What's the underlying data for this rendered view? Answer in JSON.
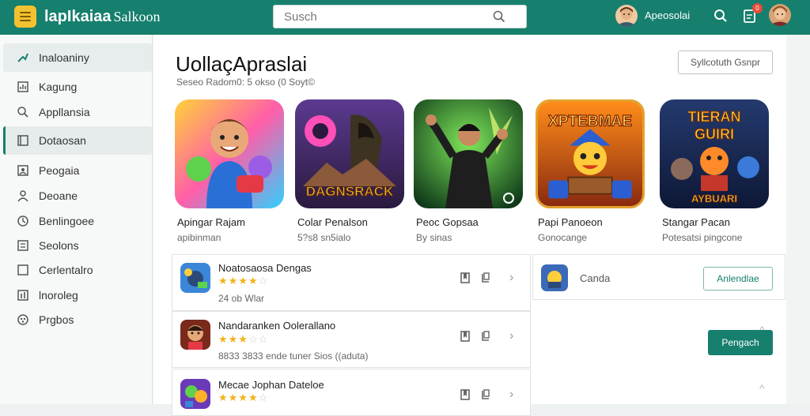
{
  "header": {
    "app_title_bold": "lapIkaiaa",
    "app_title_light": "Salkoon",
    "search_placeholder": "Susch",
    "user_name": "Apeosolai",
    "notification_count": "0"
  },
  "sidebar": {
    "items": [
      {
        "label": "Inaloaniny",
        "icon": "trend-arrow-icon"
      },
      {
        "label": "Kagung",
        "icon": "chart-icon"
      },
      {
        "label": "Appllansia",
        "icon": "search-icon"
      },
      {
        "label": "Dotaosan",
        "icon": "bookmark-icon"
      },
      {
        "label": "Peogaia",
        "icon": "people-icon"
      },
      {
        "label": "Deoane",
        "icon": "person-icon"
      },
      {
        "label": "Benlingoee",
        "icon": "clock-icon"
      },
      {
        "label": "Seolons",
        "icon": "list-icon"
      },
      {
        "label": "Cerlentalro",
        "icon": "square-icon"
      },
      {
        "label": "lnoroleg",
        "icon": "bar-chart-icon"
      },
      {
        "label": "Prgbos",
        "icon": "puzzle-icon"
      }
    ]
  },
  "main": {
    "title": "UollaçApraslai",
    "subtitle": "Seseo Radom0: 5 okso (0 Soyt©",
    "header_button": "Syllcotuth Gsnpr",
    "featured": [
      {
        "name": "Apingar Rajam",
        "meta": "apibinman"
      },
      {
        "name": "Colar Penalson",
        "meta": "5?s8 sn5ialo"
      },
      {
        "name": "Peoc Gopsaa",
        "meta": "By sinas"
      },
      {
        "name": "Papi Panoeon",
        "meta": "Gonocange"
      },
      {
        "name": "Stangar Pacan",
        "meta": "Potesatsi pingcone"
      }
    ],
    "rows": [
      {
        "title": "Noatosaosa Dengas",
        "rating": 4,
        "meta": "24 ob Wlar"
      },
      {
        "title": "Nandaranken Oolerallano",
        "rating": 3,
        "meta": "8833 3833 ende tuner Sios ((aduta)"
      },
      {
        "title": "Mecae Jophan Dateloe",
        "rating": 4,
        "meta": ""
      }
    ],
    "side_card": {
      "label": "Canda",
      "button": "Anlendlae"
    },
    "primary_button": "Pengach"
  }
}
